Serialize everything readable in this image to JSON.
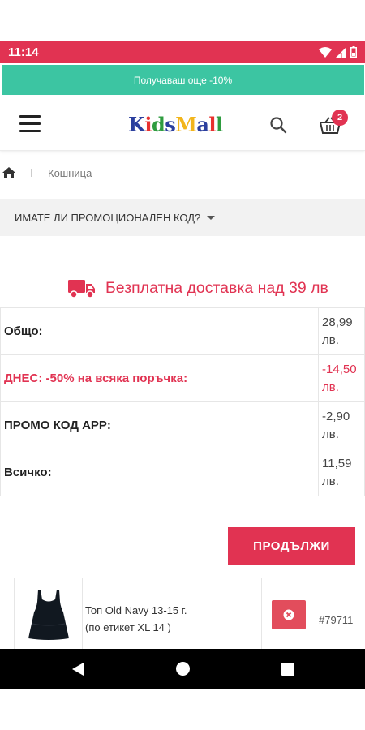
{
  "status_bar": {
    "time": "11:14",
    "icons": [
      "wifi-icon",
      "signal-icon",
      "battery-icon"
    ],
    "background": "#e13352"
  },
  "promo_banner": {
    "text": "Получаваш още -10%",
    "background": "#3cc5a2"
  },
  "header": {
    "logo_letters": [
      {
        "char": "K",
        "color": "#2b3f9e"
      },
      {
        "char": "i",
        "color": "#e8312f"
      },
      {
        "char": "d",
        "color": "#2e9c3f"
      },
      {
        "char": "s",
        "color": "#2b3f9e"
      },
      {
        "char": "M",
        "color": "#f2b51c"
      },
      {
        "char": "a",
        "color": "#2b3f9e"
      },
      {
        "char": "l",
        "color": "#e8312f"
      },
      {
        "char": "l",
        "color": "#2e9c3f"
      }
    ],
    "cart_count": "2",
    "icons": [
      "menu-icon",
      "search-icon",
      "cart-icon"
    ]
  },
  "breadcrumb": {
    "current": "Кошница",
    "home_icon": "home-icon"
  },
  "promo_code": {
    "label": "ИМАТЕ ЛИ ПРОМОЦИОНАЛЕН КОД?"
  },
  "free_shipping": {
    "text": "Безплатна доставка над 39 лв",
    "icon": "truck-icon"
  },
  "totals": [
    {
      "label": "Общо:",
      "value": "28,99 лв."
    },
    {
      "label": "ДНЕС: -50% на всяка поръчка:",
      "value": "-14,50 лв."
    },
    {
      "label": "ПРОМО КОД APP:",
      "value": "-2,90 лв."
    },
    {
      "label": "Всичко:",
      "value": "11,59 лв."
    }
  ],
  "continue_button": {
    "label": "ПРОДЪЛЖИ"
  },
  "cart_item": {
    "name_line1": "Топ Old Navy 13-15 г.",
    "name_line2": "(по етикет XL 14 )",
    "sku": "#79711",
    "remove_icon": "close-circle-icon"
  },
  "nav_bar": {
    "icons": [
      "back-icon",
      "home-button-icon",
      "recents-icon"
    ]
  },
  "colors": {
    "accent": "#e13352",
    "banner": "#3cc5a2"
  }
}
